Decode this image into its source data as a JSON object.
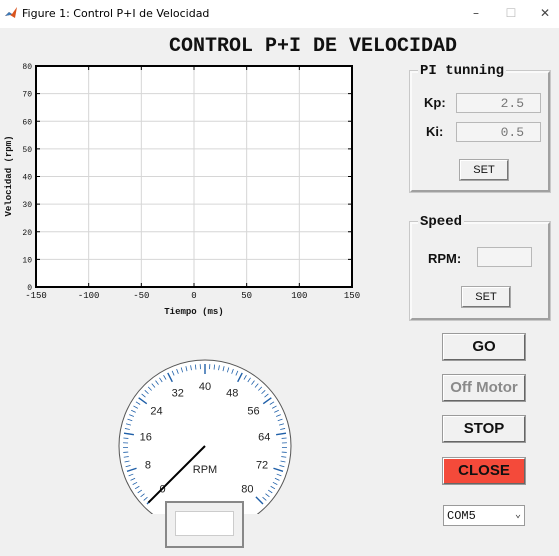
{
  "window": {
    "title": "Figure 1: Control P+I de Velocidad",
    "minimize": "–",
    "maximize": "☐",
    "close": "✕"
  },
  "main_title": "CONTROL P+I DE VELOCIDAD",
  "chart_data": {
    "type": "line",
    "xlabel": "Tiempo (ms)",
    "ylabel": "Velocidad (rpm)",
    "xlim": [
      -150,
      150
    ],
    "ylim": [
      0,
      80
    ],
    "xticks": [
      -150,
      -100,
      -50,
      0,
      50,
      100,
      150
    ],
    "yticks": [
      0,
      10,
      20,
      30,
      40,
      50,
      60,
      70,
      80
    ],
    "grid": true,
    "series": []
  },
  "pi_panel": {
    "title": "PI tunning",
    "kp_label": "Kp:",
    "kp_value": "2.5",
    "ki_label": "Ki:",
    "ki_value": "0.5",
    "set_label": "SET"
  },
  "speed_panel": {
    "title": "Speed",
    "rpm_label": "RPM:",
    "rpm_value": "",
    "set_label": "SET"
  },
  "buttons": {
    "go": "GO",
    "off_motor": "Off Motor",
    "stop": "STOP",
    "close": "CLOSE"
  },
  "colors": {
    "close_button": "#f44a3a",
    "gauge_ticks": "#1f5fa8"
  },
  "port_select": {
    "selected": "COM5"
  },
  "gauge": {
    "unit_label": "RPM",
    "min": 0,
    "max": 80,
    "major_labels": [
      "0",
      "8",
      "16",
      "24",
      "32",
      "40",
      "48",
      "56",
      "64",
      "72",
      "80"
    ],
    "needle_value": 0,
    "readout": ""
  }
}
